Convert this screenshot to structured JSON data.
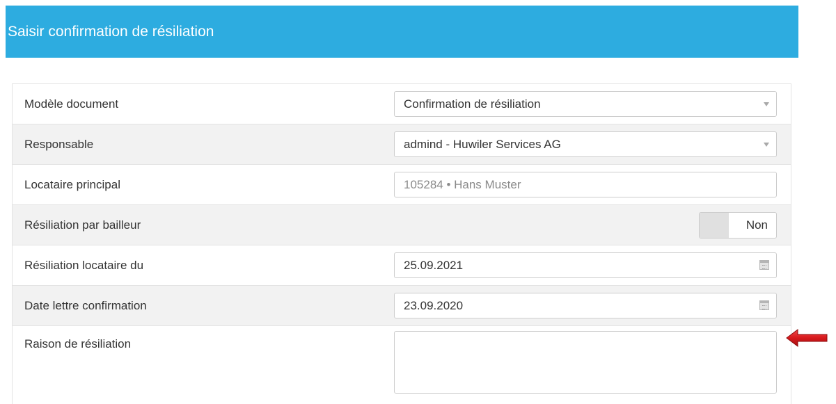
{
  "dialog": {
    "title": "Saisir confirmation de résiliation"
  },
  "form": {
    "template": {
      "label": "Modèle document",
      "value": "Confirmation de résiliation",
      "icon": "chevron-down-icon"
    },
    "responsible": {
      "label": "Responsable",
      "value": "admind - Huwiler Services AG",
      "icon": "chevron-down-icon"
    },
    "main_tenant": {
      "label": "Locataire principal",
      "value": "105284 • Hans Muster"
    },
    "termination_by_landlord": {
      "label": "Résiliation par bailleur",
      "value": "Non"
    },
    "tenant_termination_date": {
      "label": "Résiliation locataire du",
      "value": "25.09.2021",
      "icon": "calendar-icon"
    },
    "confirmation_letter_date": {
      "label": "Date lettre confirmation",
      "value": "23.09.2020",
      "icon": "calendar-icon"
    },
    "termination_reason": {
      "label": "Raison de résiliation",
      "value": ""
    }
  },
  "annotation": {
    "icon": "red-arrow-left-icon",
    "color": "#d7191c"
  },
  "colors": {
    "header_bg": "#2dace0",
    "row_alt_bg": "#f2f2f2"
  }
}
